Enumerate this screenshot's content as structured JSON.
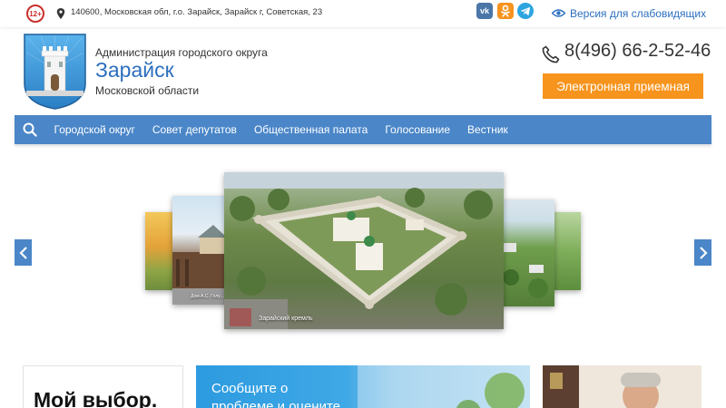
{
  "topbar": {
    "age_rating": "12+",
    "address": "140600, Московская обл, г.о. Зарайск, Зарайск г, Советская, 23",
    "social": {
      "vk": "vk",
      "ok": "ok",
      "telegram": "tg"
    },
    "vision_link": "Версия для слабовидящих"
  },
  "header": {
    "org_line1": "Администрация городского округа",
    "org_city": "Зарайск",
    "org_line3": "Московской области",
    "phone": "8(496) 66-2-52-46",
    "reception_button": "Электронная приемная"
  },
  "nav": {
    "items": [
      "Городской округ",
      "Совет депутатов",
      "Общественная палата",
      "Голосование",
      "Вестник"
    ]
  },
  "carousel": {
    "main_caption": "Зарайский кремль",
    "left_caption": "Дом А.С. Голу..."
  },
  "cards": {
    "card1_text": "Мой выбор.",
    "card2_text": "Сообщите о\nпроблеме и оцените"
  },
  "colors": {
    "accent_blue": "#4a86c8",
    "link_blue": "#2c6fbf",
    "orange": "#f7941d",
    "age_red": "#c9302c"
  },
  "icons": [
    "location-icon",
    "vk-icon",
    "ok-icon",
    "telegram-icon",
    "eye-icon",
    "phone-icon",
    "search-icon",
    "chevron-left-icon",
    "chevron-right-icon"
  ]
}
